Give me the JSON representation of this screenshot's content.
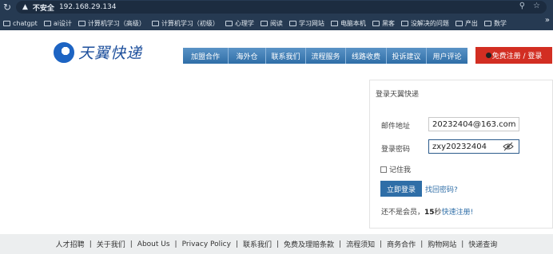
{
  "browser": {
    "security_label": "不安全",
    "url": "192.168.29.134",
    "bookmarks": [
      {
        "label": "chatgpt"
      },
      {
        "label": "ai设计"
      },
      {
        "label": "计算机学习（高级）"
      },
      {
        "label": "计算机学习（初级）"
      },
      {
        "label": "心理学"
      },
      {
        "label": "阅读"
      },
      {
        "label": "学习网站"
      },
      {
        "label": "电脑本机"
      },
      {
        "label": "黑客"
      },
      {
        "label": "没解决的问题"
      },
      {
        "label": "产出"
      },
      {
        "label": "数学"
      }
    ]
  },
  "logo": {
    "text": "天翼快递",
    "brand_color": "#1d64c3"
  },
  "nav": {
    "items": [
      {
        "label": "加盟合作"
      },
      {
        "label": "海外仓"
      },
      {
        "label": "联系我们"
      },
      {
        "label": "流程服务"
      },
      {
        "label": "线路收费"
      },
      {
        "label": "投诉建议"
      },
      {
        "label": "用户评论"
      }
    ],
    "register_login": "免费注册 / 登录",
    "accent": "#d22e22"
  },
  "login": {
    "title": "登录天翼快递",
    "email_label": "邮件地址",
    "email_value": "20232404@163.com",
    "password_label": "登录密码",
    "password_value": "zxy20232404",
    "remember_label": "记住我",
    "login_button": "立即登录",
    "forgot_link": "找回密码?",
    "not_member_prefix": "还不是会员，",
    "countdown": "15",
    "countdown_suffix": "秒",
    "quick_register": "快速注册!"
  },
  "footer": {
    "links": [
      {
        "label": "人才招聘"
      },
      {
        "label": "关于我们"
      },
      {
        "label": "About Us"
      },
      {
        "label": "Privacy Policy"
      },
      {
        "label": "联系我们"
      },
      {
        "label": "免费及理赔条款"
      },
      {
        "label": "流程须知"
      },
      {
        "label": "商务合作"
      },
      {
        "label": "购物网站"
      },
      {
        "label": "快递查询"
      }
    ]
  }
}
